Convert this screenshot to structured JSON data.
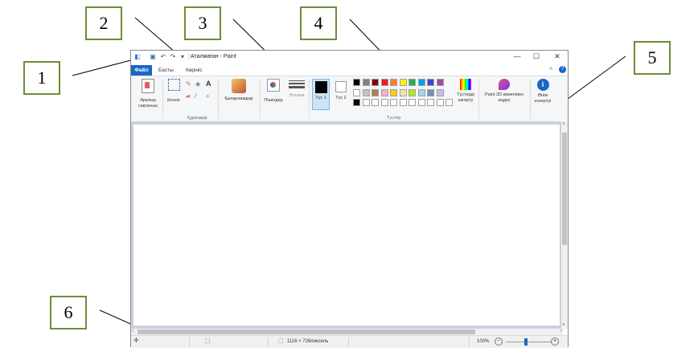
{
  "callouts": [
    "1",
    "2",
    "3",
    "4",
    "5",
    "6"
  ],
  "window": {
    "title": "Аталмаған - Paint",
    "controls": {
      "minimize": "—",
      "maximize": "☐",
      "close": "✕"
    }
  },
  "tabs": {
    "file": "Файл",
    "home": "Басты",
    "view": "Көрініс"
  },
  "ribbon": {
    "clipboard_label": "Аралық сақтағыш",
    "select_label": "Кескін",
    "tools_group": "Құралдар",
    "brushes_label": "Қылқаламдар",
    "shapes_label": "Пішіндер",
    "size_label": "Өлшем",
    "color1_label": "Түс 1",
    "color2_label": "Түс 2",
    "colors_group": "Түстер",
    "edit_colors_label": "Түстерді өзгерту",
    "paint3d_label": "Paint 3D көмегімен өңдеу",
    "product_alert_label": "Өнім ескертуі"
  },
  "palette": {
    "row1": [
      "#000000",
      "#7f7f7f",
      "#880015",
      "#ed1c24",
      "#ff7f27",
      "#fff200",
      "#22b14c",
      "#00a2e8",
      "#3f48cc",
      "#a349a4"
    ],
    "row2": [
      "#ffffff",
      "#c3c3c3",
      "#b97a57",
      "#ffaec9",
      "#ffc90e",
      "#efe4b0",
      "#b5e61d",
      "#99d9ea",
      "#7092be",
      "#c8bfe7"
    ],
    "row3": [
      "#000000",
      "#ffffff",
      "#ffffff",
      "#ffffff",
      "#ffffff",
      "#ffffff",
      "#ffffff",
      "#ffffff",
      "#ffffff",
      "#ffffff",
      "#ffffff"
    ]
  },
  "status": {
    "dimensions": "1116 × 726пиксель",
    "zoom": "100%"
  }
}
